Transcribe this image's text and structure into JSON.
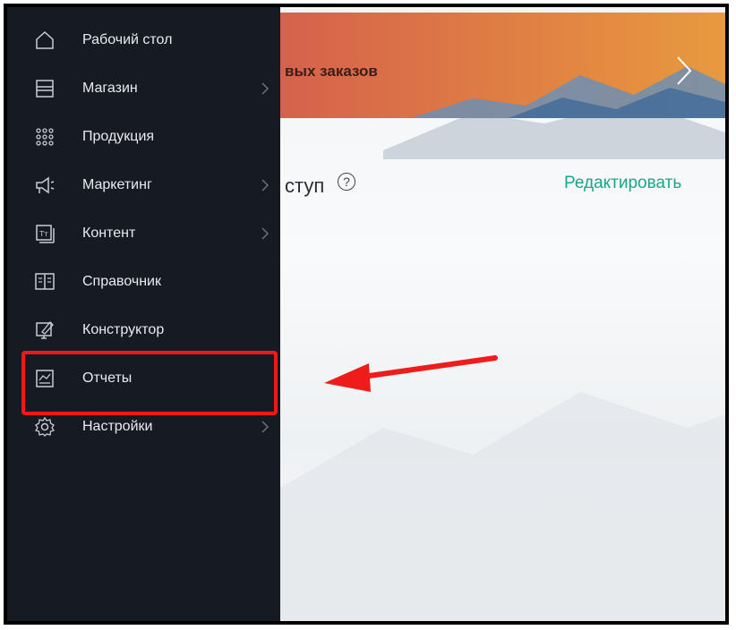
{
  "sidebar": {
    "items": [
      {
        "label": "Рабочий стол",
        "icon": "home-icon",
        "has_submenu": false
      },
      {
        "label": "Магазин",
        "icon": "store-icon",
        "has_submenu": true
      },
      {
        "label": "Продукция",
        "icon": "grid-icon",
        "has_submenu": false
      },
      {
        "label": "Маркетинг",
        "icon": "megaphone-icon",
        "has_submenu": true
      },
      {
        "label": "Контент",
        "icon": "text-box-icon",
        "has_submenu": true
      },
      {
        "label": "Справочник",
        "icon": "book-icon",
        "has_submenu": false
      },
      {
        "label": "Конструктор",
        "icon": "design-icon",
        "has_submenu": false
      },
      {
        "label": "Отчеты",
        "icon": "reports-icon",
        "has_submenu": false,
        "highlighted": true
      },
      {
        "label": "Настройки",
        "icon": "gear-icon",
        "has_submenu": true
      }
    ]
  },
  "banner": {
    "text": "вых заказов",
    "arrow_icon": "chevron-right-icon"
  },
  "main": {
    "section_title": "ступ",
    "help_icon": "?",
    "edit_label": "Редактировать"
  },
  "colors": {
    "sidebar_bg": "#161a22",
    "accent_green": "#19a58d",
    "highlight_red": "#f01818"
  }
}
